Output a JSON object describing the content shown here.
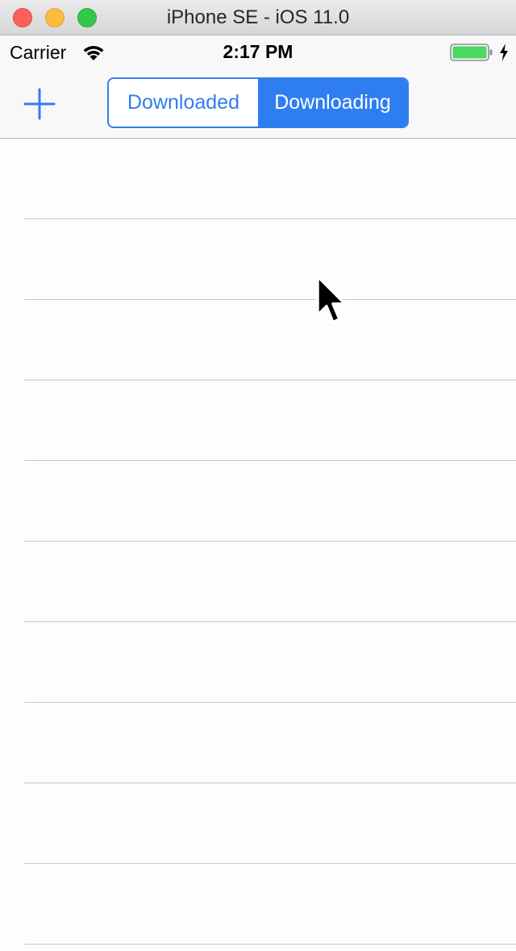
{
  "window": {
    "title": "iPhone SE - iOS 11.0"
  },
  "status_bar": {
    "carrier": "Carrier",
    "time": "2:17 PM",
    "wifi_icon": "wifi-icon",
    "battery_icon": "battery-full-icon",
    "charging_icon": "charging-bolt-icon"
  },
  "nav": {
    "add_icon": "plus-icon",
    "segments": [
      {
        "label": "Downloaded",
        "selected": false
      },
      {
        "label": "Downloading",
        "selected": true
      }
    ]
  },
  "table": {
    "rows": [
      "",
      "",
      "",
      "",
      "",
      "",
      "",
      "",
      "",
      ""
    ]
  },
  "colors": {
    "tint": "#2f7ef1",
    "separator": "#c8c7cc",
    "battery": "#4cd964"
  }
}
